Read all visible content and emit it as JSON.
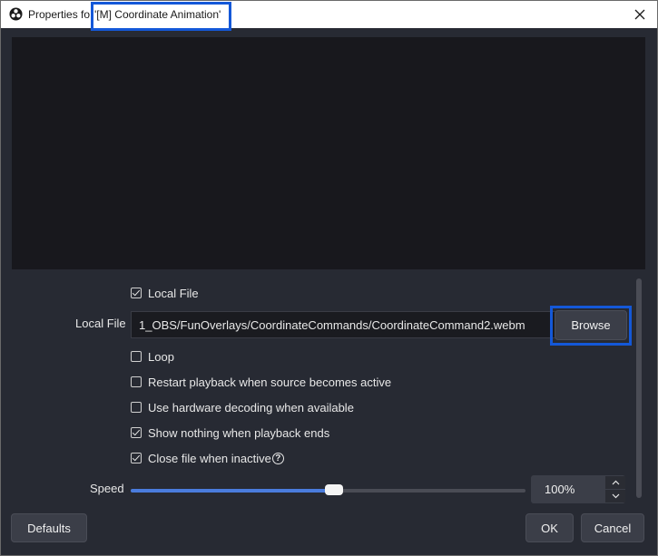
{
  "window": {
    "title_prefix": "Properties fo",
    "title_name": "'[M] Coordinate Animation'",
    "close_glyph": "✕"
  },
  "colors": {
    "window_bg": "#272a33",
    "preview_bg": "#18181d",
    "accent": "#4a7cdd",
    "highlight_outline": "#1458d8"
  },
  "properties": {
    "local_file_checkbox": {
      "label": "Local File",
      "checked": true
    },
    "local_file": {
      "label": "Local File",
      "value": "1_OBS/FunOverlays/CoordinateCommands/CoordinateCommand2.webm",
      "browse_label": "Browse"
    },
    "options": [
      {
        "label": "Loop",
        "checked": false
      },
      {
        "label": "Restart playback when source becomes active",
        "checked": false
      },
      {
        "label": "Use hardware decoding when available",
        "checked": false
      },
      {
        "label": "Show nothing when playback ends",
        "checked": true
      },
      {
        "label": "Close file when inactive",
        "checked": true,
        "help_icon": "?"
      }
    ],
    "speed": {
      "label": "Speed",
      "value_text": "100%",
      "slider_fraction": 0.5
    }
  },
  "footer": {
    "defaults_label": "Defaults",
    "ok_label": "OK",
    "cancel_label": "Cancel"
  }
}
